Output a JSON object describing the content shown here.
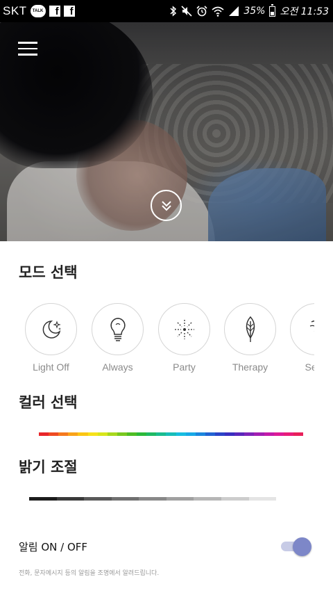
{
  "status_bar": {
    "carrier": "SKT",
    "talk_badge": "TALK",
    "fb_letter": "f",
    "battery_percent": "35%",
    "time": "오전 11:53",
    "icons": [
      "kakaotalk-icon",
      "facebook-icon",
      "facebook-icon",
      "bluetooth-icon",
      "mute-icon",
      "alarm-icon",
      "wifi-icon",
      "signal-icon",
      "battery-icon"
    ]
  },
  "hero": {
    "menu_icon": "hamburger-menu-icon",
    "expand_icon": "double-chevron-down-icon"
  },
  "mode_section": {
    "title": "모드 선택",
    "modes": [
      {
        "label": "Light Off",
        "icon": "moon-stars-icon"
      },
      {
        "label": "Always",
        "icon": "light-bulb-icon"
      },
      {
        "label": "Party",
        "icon": "firework-icon"
      },
      {
        "label": "Therapy",
        "icon": "leaf-icon"
      },
      {
        "label": "Seve",
        "icon": "partial-icon"
      }
    ]
  },
  "color_section": {
    "title": "컬러 선택",
    "colors": [
      "#e8262a",
      "#ef4b23",
      "#f5791f",
      "#f9a31a",
      "#fbc614",
      "#f6e11a",
      "#d8e51b",
      "#a8d81d",
      "#79c81f",
      "#4ebd24",
      "#2cb93a",
      "#1fb964",
      "#1abc8f",
      "#18bdb8",
      "#17bde0",
      "#17a9e6",
      "#1b86de",
      "#2263d3",
      "#2b44c8",
      "#3a2fc0",
      "#5a27bb",
      "#7e24b8",
      "#a21fb2",
      "#c31aa9",
      "#dd1a96",
      "#e81c79",
      "#e8205a"
    ]
  },
  "brightness_section": {
    "title": "밝기 조절",
    "levels": [
      "#1c1c1c",
      "#3a3a3a",
      "#595959",
      "#707070",
      "#888888",
      "#a0a0a0",
      "#b6b6b6",
      "#cdcdcd",
      "#e4e4e4"
    ]
  },
  "notification": {
    "label": "알림 ON / OFF",
    "enabled": true,
    "description": "전화, 문자메시지 등의 알림을 조명에서 알려드립니다.",
    "accent_color": "#7d87c8"
  }
}
